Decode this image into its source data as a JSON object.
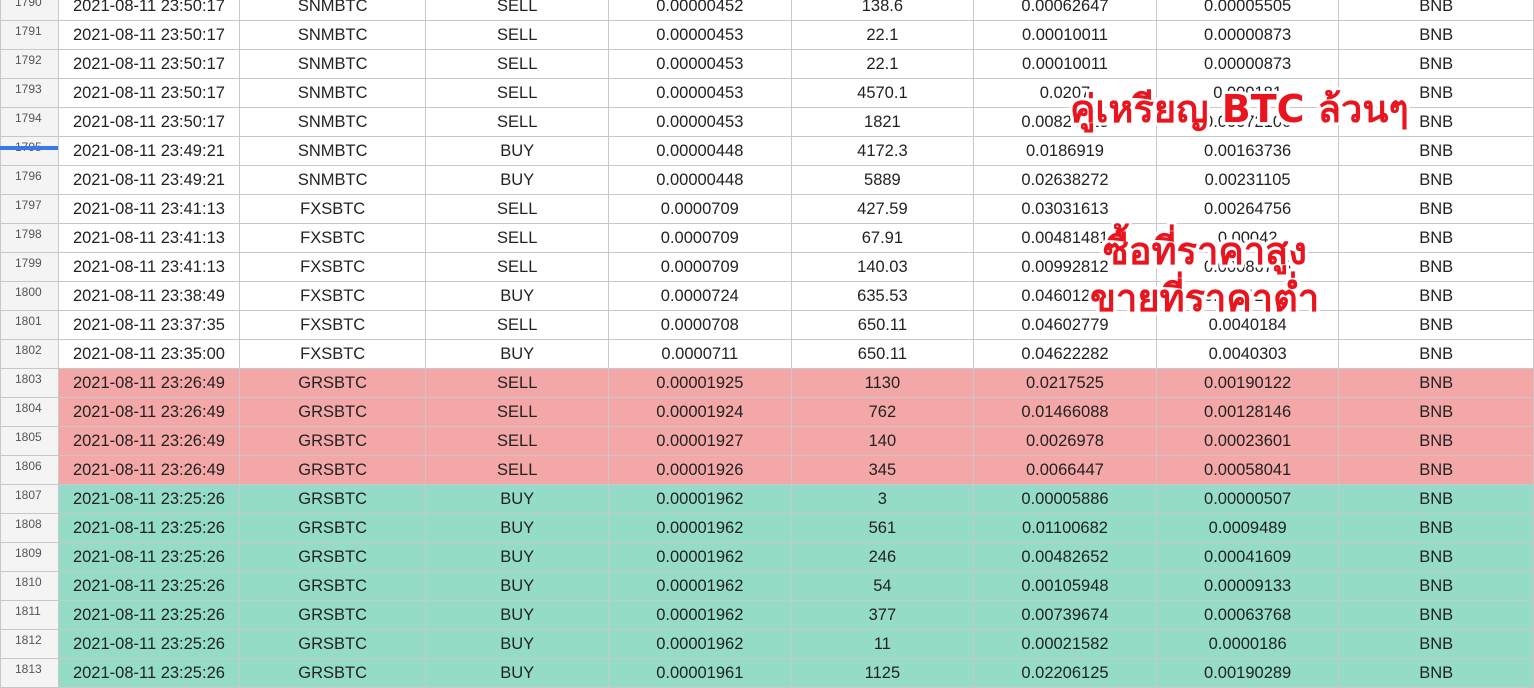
{
  "annotations": {
    "line1": "คู่เหรียญ BTC ล้วนๆ",
    "line2": "ซื้อที่ราคาสูง",
    "line3": "ขายที่ราคาต่ำ"
  },
  "colors": {
    "sell_highlight": "#f4a7a7",
    "buy_highlight": "#94dcc8",
    "annotation_text": "#e9141e"
  },
  "rows": [
    {
      "n": "1790",
      "hl": "",
      "cells": [
        "2021-08-11 23:50:17",
        "SNMBTC",
        "SELL",
        "0.00000452",
        "138.6",
        "0.00062647",
        "0.00005505",
        "BNB"
      ]
    },
    {
      "n": "1791",
      "hl": "",
      "cells": [
        "2021-08-11 23:50:17",
        "SNMBTC",
        "SELL",
        "0.00000453",
        "22.1",
        "0.00010011",
        "0.00000873",
        "BNB"
      ]
    },
    {
      "n": "1792",
      "hl": "",
      "cells": [
        "2021-08-11 23:50:17",
        "SNMBTC",
        "SELL",
        "0.00000453",
        "22.1",
        "0.00010011",
        "0.00000873",
        "BNB"
      ]
    },
    {
      "n": "1793",
      "hl": "",
      "cells": [
        "2021-08-11 23:50:17",
        "SNMBTC",
        "SELL",
        "0.00000453",
        "4570.1",
        "0.0207",
        "0.000181",
        "BNB"
      ]
    },
    {
      "n": "1794",
      "hl": "",
      "cells": [
        "2021-08-11 23:50:17",
        "SNMBTC",
        "SELL",
        "0.00000453",
        "1821",
        "0.00824913",
        "0.00072106",
        "BNB"
      ]
    },
    {
      "n": "1795",
      "hl": "",
      "cells": [
        "2021-08-11 23:49:21",
        "SNMBTC",
        "BUY",
        "0.00000448",
        "4172.3",
        "0.0186919",
        "0.00163736",
        "BNB"
      ]
    },
    {
      "n": "1796",
      "hl": "",
      "cells": [
        "2021-08-11 23:49:21",
        "SNMBTC",
        "BUY",
        "0.00000448",
        "5889",
        "0.02638272",
        "0.00231105",
        "BNB"
      ]
    },
    {
      "n": "1797",
      "hl": "",
      "cells": [
        "2021-08-11 23:41:13",
        "FXSBTC",
        "SELL",
        "0.0000709",
        "427.59",
        "0.03031613",
        "0.00264756",
        "BNB"
      ]
    },
    {
      "n": "1798",
      "hl": "",
      "cells": [
        "2021-08-11 23:41:13",
        "FXSBTC",
        "SELL",
        "0.0000709",
        "67.91",
        "0.00481481",
        "0.00042",
        "BNB"
      ]
    },
    {
      "n": "1799",
      "hl": "",
      "cells": [
        "2021-08-11 23:41:13",
        "FXSBTC",
        "SELL",
        "0.0000709",
        "140.03",
        "0.00992812",
        "0.00086705",
        "BNB"
      ]
    },
    {
      "n": "1800",
      "hl": "",
      "cells": [
        "2021-08-11 23:38:49",
        "FXSBTC",
        "BUY",
        "0.0000724",
        "635.53",
        "0.04601237",
        "0.00402322",
        "BNB"
      ]
    },
    {
      "n": "1801",
      "hl": "",
      "cells": [
        "2021-08-11 23:37:35",
        "FXSBTC",
        "SELL",
        "0.0000708",
        "650.11",
        "0.04602779",
        "0.0040184",
        "BNB"
      ]
    },
    {
      "n": "1802",
      "hl": "",
      "cells": [
        "2021-08-11 23:35:00",
        "FXSBTC",
        "BUY",
        "0.0000711",
        "650.11",
        "0.04622282",
        "0.0040303",
        "BNB"
      ]
    },
    {
      "n": "1803",
      "hl": "red",
      "cells": [
        "2021-08-11 23:26:49",
        "GRSBTC",
        "SELL",
        "0.00001925",
        "1130",
        "0.0217525",
        "0.00190122",
        "BNB"
      ]
    },
    {
      "n": "1804",
      "hl": "red",
      "cells": [
        "2021-08-11 23:26:49",
        "GRSBTC",
        "SELL",
        "0.00001924",
        "762",
        "0.01466088",
        "0.00128146",
        "BNB"
      ]
    },
    {
      "n": "1805",
      "hl": "red",
      "cells": [
        "2021-08-11 23:26:49",
        "GRSBTC",
        "SELL",
        "0.00001927",
        "140",
        "0.0026978",
        "0.00023601",
        "BNB"
      ]
    },
    {
      "n": "1806",
      "hl": "red",
      "cells": [
        "2021-08-11 23:26:49",
        "GRSBTC",
        "SELL",
        "0.00001926",
        "345",
        "0.0066447",
        "0.00058041",
        "BNB"
      ]
    },
    {
      "n": "1807",
      "hl": "green",
      "cells": [
        "2021-08-11 23:25:26",
        "GRSBTC",
        "BUY",
        "0.00001962",
        "3",
        "0.00005886",
        "0.00000507",
        "BNB"
      ]
    },
    {
      "n": "1808",
      "hl": "green",
      "cells": [
        "2021-08-11 23:25:26",
        "GRSBTC",
        "BUY",
        "0.00001962",
        "561",
        "0.01100682",
        "0.0009489",
        "BNB"
      ]
    },
    {
      "n": "1809",
      "hl": "green",
      "cells": [
        "2021-08-11 23:25:26",
        "GRSBTC",
        "BUY",
        "0.00001962",
        "246",
        "0.00482652",
        "0.00041609",
        "BNB"
      ]
    },
    {
      "n": "1810",
      "hl": "green",
      "cells": [
        "2021-08-11 23:25:26",
        "GRSBTC",
        "BUY",
        "0.00001962",
        "54",
        "0.00105948",
        "0.00009133",
        "BNB"
      ]
    },
    {
      "n": "1811",
      "hl": "green",
      "cells": [
        "2021-08-11 23:25:26",
        "GRSBTC",
        "BUY",
        "0.00001962",
        "377",
        "0.00739674",
        "0.00063768",
        "BNB"
      ]
    },
    {
      "n": "1812",
      "hl": "green",
      "cells": [
        "2021-08-11 23:25:26",
        "GRSBTC",
        "BUY",
        "0.00001962",
        "11",
        "0.00021582",
        "0.0000186",
        "BNB"
      ]
    },
    {
      "n": "1813",
      "hl": "green",
      "cells": [
        "2021-08-11 23:25:26",
        "GRSBTC",
        "BUY",
        "0.00001961",
        "1125",
        "0.02206125",
        "0.00190289",
        "BNB"
      ]
    }
  ]
}
